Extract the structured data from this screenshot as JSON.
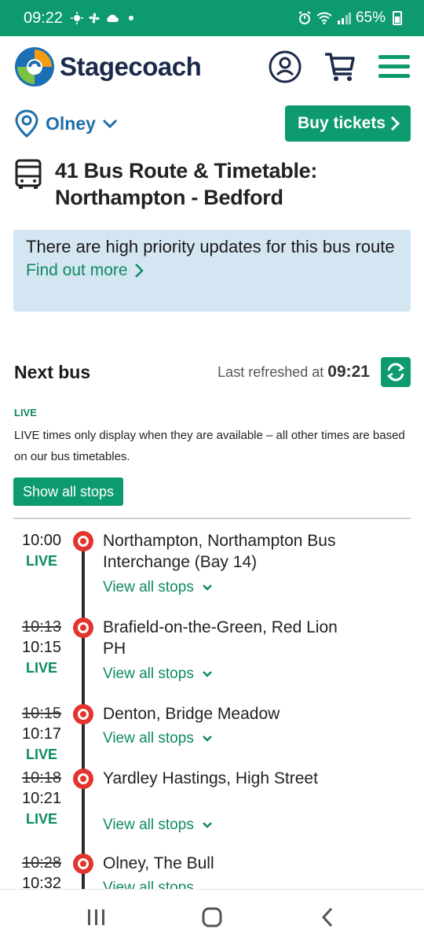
{
  "status_bar": {
    "time": "09:22",
    "battery": "65%"
  },
  "header": {
    "brand": "Stagecoach",
    "icons": [
      "account-icon",
      "cart-icon",
      "menu-icon"
    ]
  },
  "location": {
    "name": "Olney"
  },
  "buy_tickets": {
    "label": "Buy tickets"
  },
  "route": {
    "title_line1": "41 Bus Route & Timetable:",
    "title_line2": "Northampton - Bedford"
  },
  "alert": {
    "text": "There are high priority updates for this bus route",
    "link": "Find out more"
  },
  "next_bus": {
    "title": "Next bus",
    "refreshed_label": "Last refreshed at",
    "refreshed_time": "09:21"
  },
  "live_info": {
    "tag": "LIVE",
    "note": "LIVE times only display when they are available – all other times are based on our bus timetables."
  },
  "show_all_stops": "Show all stops",
  "view_all_label": "View all stops",
  "stops": [
    {
      "scheduled": "",
      "time": "10:00",
      "status": "LIVE",
      "name": "Northampton, Northampton Bus Interchange (Bay 14)"
    },
    {
      "scheduled": "10:13",
      "time": "10:15",
      "status": "LIVE",
      "name": "Brafield-on-the-Green, Red Lion PH"
    },
    {
      "scheduled": "10:15",
      "time": "10:17",
      "status": "LIVE",
      "name": "Denton, Bridge Meadow"
    },
    {
      "scheduled": "10:18",
      "time": "10:21",
      "status": "LIVE",
      "name": "Yardley Hastings, High Street"
    },
    {
      "scheduled": "10:28",
      "time": "10:32",
      "status": "",
      "name": "Olney, The Bull"
    }
  ],
  "colors": {
    "brand_green": "#0d9a6e",
    "link_blue": "#1e6fa8",
    "alert_bg": "#d5e6f3",
    "stop_red": "#e3342f"
  }
}
